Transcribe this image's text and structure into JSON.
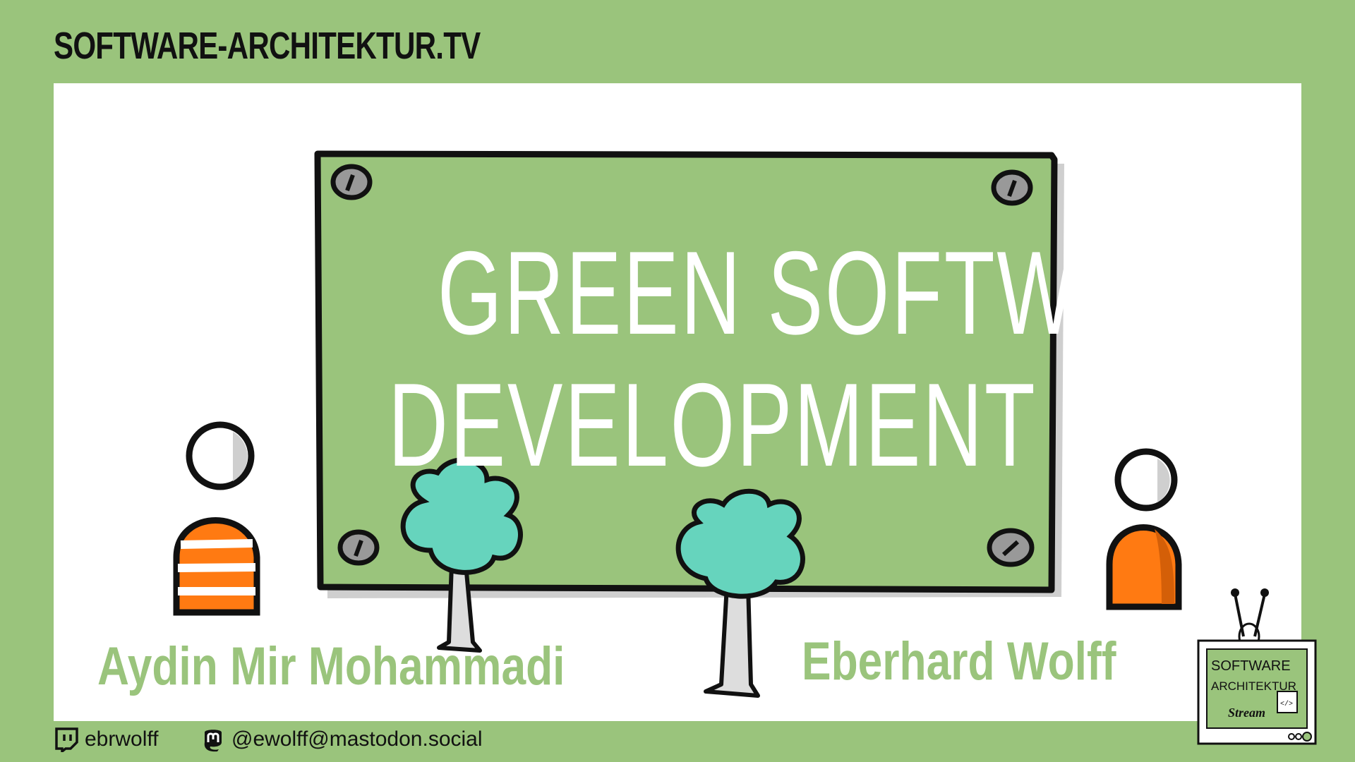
{
  "header": {
    "site": "SOFTWARE-ARCHITEKTUR.TV"
  },
  "board": {
    "line1": "GREEN SOFTWARE",
    "line2": "DEVELOPMENT"
  },
  "speakers": {
    "left": "Aydin Mir Mohammadi",
    "right": "Eberhard Wolff"
  },
  "footer": {
    "twitch_handle": "ebrwolff",
    "mastodon_handle": "@ewolff@mastodon.social",
    "twitch_icon": "twitch-icon",
    "mastodon_icon": "mastodon-icon"
  },
  "logo": {
    "line1": "SOFTWARE",
    "line2": "ARCHITEKTUR",
    "line3": "Stream",
    "tag": "</>"
  },
  "colors": {
    "background": "#9ac47c",
    "board": "#9ac47c",
    "tree_crown": "#66d4bd",
    "shirt": "#ff7a12",
    "outline": "#111111"
  }
}
